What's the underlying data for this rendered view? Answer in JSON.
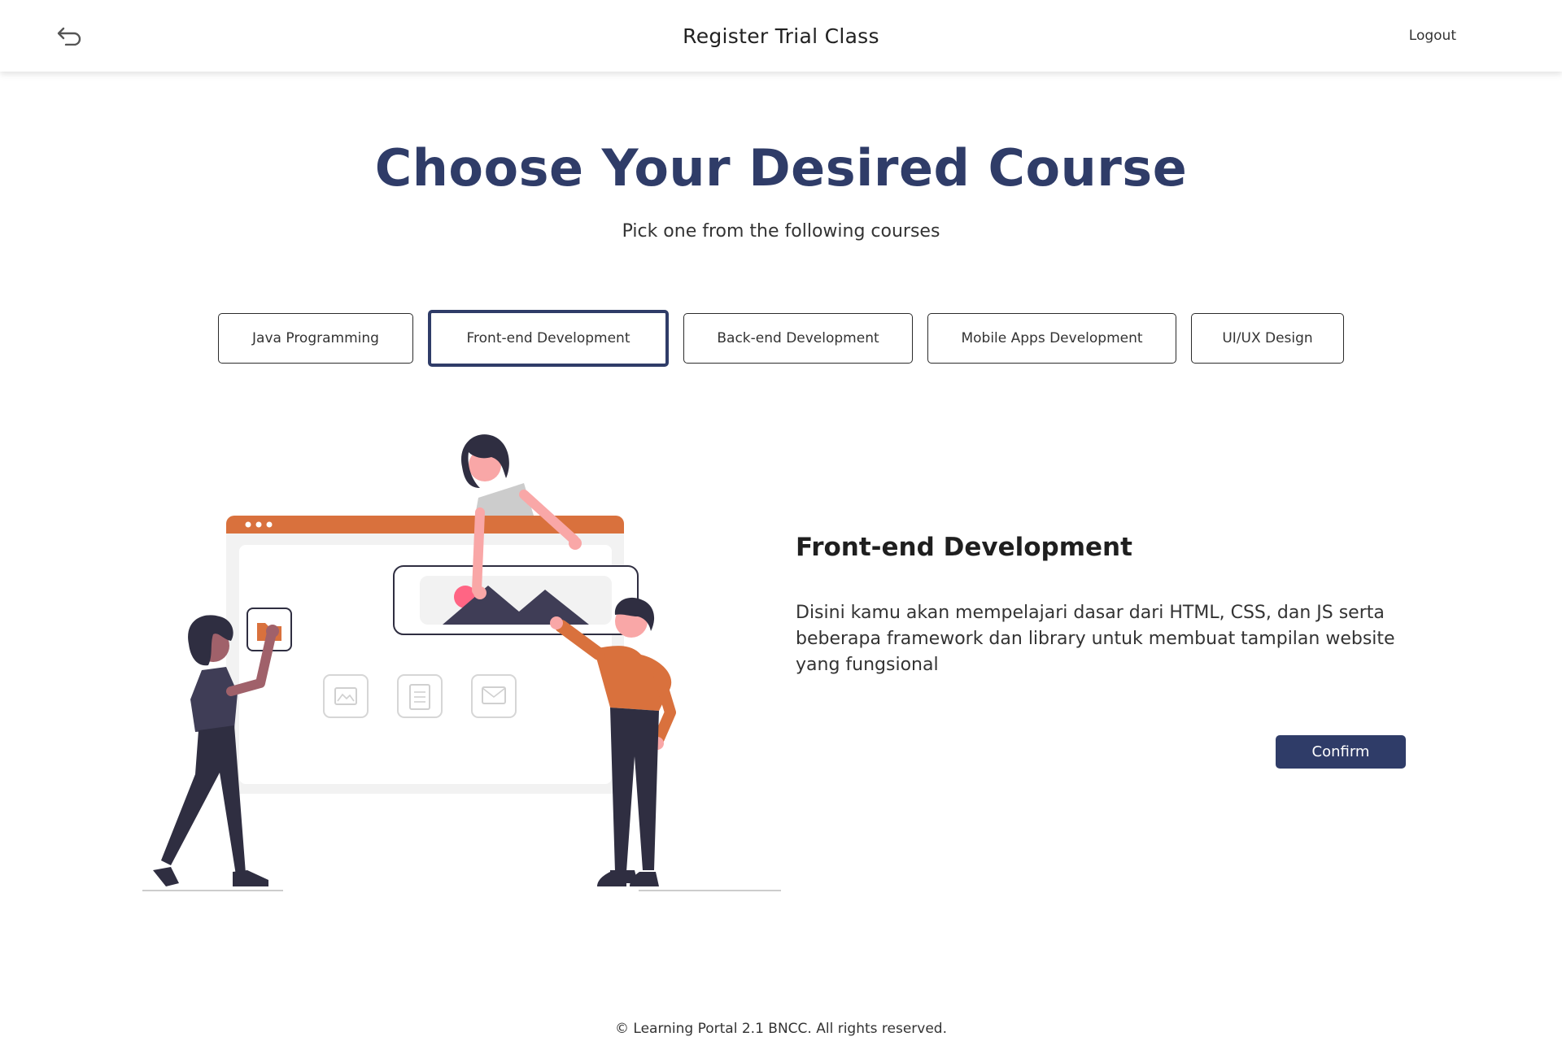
{
  "header": {
    "back_icon": "undo-arrow-icon",
    "title": "Register Trial Class",
    "logout_label": "Logout"
  },
  "hero": {
    "title": "Choose Your Desired Course",
    "subtitle": "Pick one from the following courses"
  },
  "courses": {
    "tabs": [
      {
        "label": "Java Programming",
        "selected": false
      },
      {
        "label": "Front-end Development",
        "selected": true
      },
      {
        "label": "Back-end Development",
        "selected": false
      },
      {
        "label": "Mobile Apps Development",
        "selected": false
      },
      {
        "label": "UI/UX Design",
        "selected": false
      }
    ]
  },
  "detail": {
    "title": "Front-end Development",
    "description": "Disini kamu akan mempelajari dasar dari HTML, CSS, dan JS serta beberapa framework dan library untuk membuat tampilan website yang fungsional",
    "confirm_label": "Confirm",
    "illustration_icons": [
      "folder-icon",
      "image-icon",
      "document-icon",
      "mail-icon"
    ]
  },
  "footer": {
    "copyright": "© Learning Portal 2.1 BNCC. All rights reserved."
  },
  "colors": {
    "primary": "#2f3c68",
    "accent_orange": "#d9713d",
    "skin_pink": "#f9a7a7",
    "dark_figure": "#2f2e41"
  }
}
